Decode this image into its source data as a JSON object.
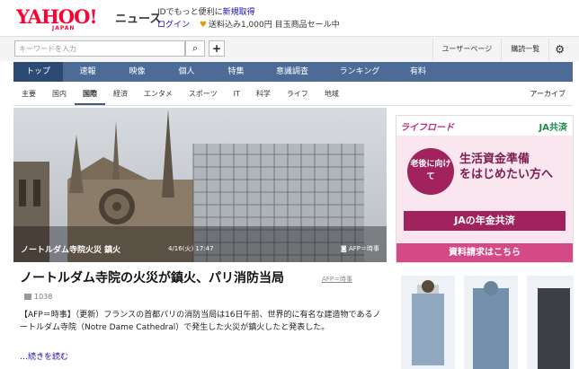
{
  "header": {
    "logo_text": "YAHOO!",
    "logo_sub": "JAPAN",
    "service": "ニュース",
    "line1_prefix": "IDでもっと便利に",
    "line1_link": "新規取得",
    "login": "ログイン",
    "promo": "送料込み1,000円 目玉商品セール中"
  },
  "search": {
    "placeholder": "キーワードを入力"
  },
  "tools": {
    "user_page": "ユーザーページ",
    "history": "購読一覧"
  },
  "nav_primary": [
    {
      "label": "トップ",
      "active": true
    },
    {
      "label": "速報"
    },
    {
      "label": "映像"
    },
    {
      "label": "個人"
    },
    {
      "label": "特集"
    },
    {
      "label": "意識調査"
    },
    {
      "label": "ランキング"
    },
    {
      "label": "有料"
    }
  ],
  "nav_secondary": [
    {
      "label": "主要"
    },
    {
      "label": "国内"
    },
    {
      "label": "国際",
      "active": true
    },
    {
      "label": "経済"
    },
    {
      "label": "エンタメ"
    },
    {
      "label": "スポーツ"
    },
    {
      "label": "IT"
    },
    {
      "label": "科学"
    },
    {
      "label": "ライフ"
    },
    {
      "label": "地域"
    }
  ],
  "nav_archive": "アーカイブ",
  "hero": {
    "caption": "ノートルダム寺院火災 鎮火",
    "date": "4/16(火) 17:47",
    "credit": "AFP＝時事"
  },
  "article": {
    "title": "ノートルダム寺院の火災が鎮火、パリ消防当局",
    "source": "AFP＝時事",
    "comments": "1038",
    "body": "【AFP＝時事】（更新）フランスの首都パリの消防当局は16日午前、世界的に有名な建造物であるノートルダム寺院（Notre Dame Cathedral）で発生した火災が鎮火したと発表した。",
    "read_more": "…続きを読む"
  },
  "ad": {
    "brand_left": "ライフロード",
    "brand_right": "JA共済",
    "circle_text": "老後に向けて",
    "headline_1": "生活資金準備",
    "headline_2": "をはじめたい方へ",
    "banner": "JAの年金共済",
    "cta": "資料請求はこちら"
  }
}
